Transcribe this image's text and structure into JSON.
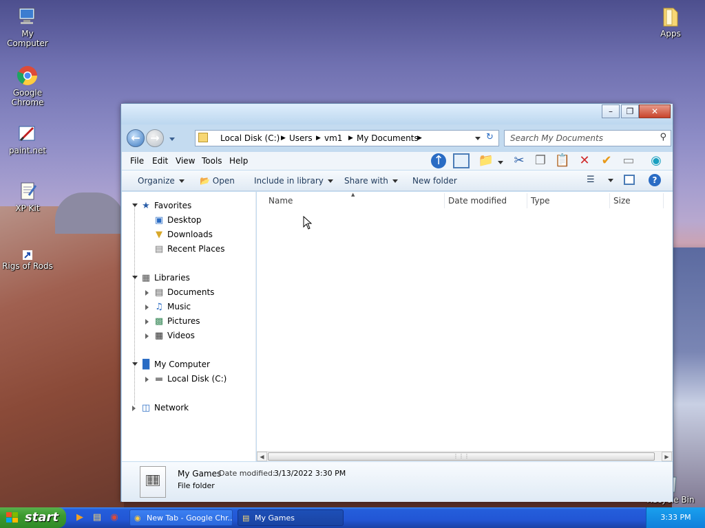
{
  "desktop": {
    "icons": [
      {
        "label": "My Computer",
        "icon": "computer-icon"
      },
      {
        "label": "Google Chrome",
        "icon": "chrome-icon"
      },
      {
        "label": "paint.net",
        "icon": "paintnet-icon"
      },
      {
        "label": "XP Kit",
        "icon": "notepad-icon"
      },
      {
        "label": "Rigs of Rods",
        "icon": "shortcut-icon"
      },
      {
        "label": "Apps",
        "icon": "folder-icon"
      },
      {
        "label": "Recycle Bin",
        "icon": "recycle-bin-icon"
      }
    ]
  },
  "window": {
    "address": {
      "crumbs": [
        "Local Disk (C:)",
        "Users",
        "vm1",
        "My Documents"
      ]
    },
    "search": {
      "placeholder": "Search My Documents"
    },
    "menu": [
      "File",
      "Edit",
      "View",
      "Tools",
      "Help"
    ],
    "commands": {
      "organize": "Organize",
      "open": "Open",
      "include": "Include in library",
      "share": "Share with",
      "new_folder": "New folder"
    },
    "nav": {
      "favorites": "Favorites",
      "desktop": "Desktop",
      "downloads": "Downloads",
      "recent": "Recent Places",
      "libraries": "Libraries",
      "documents": "Documents",
      "music": "Music",
      "pictures": "Pictures",
      "videos": "Videos",
      "computer": "My Computer",
      "localdisk": "Local Disk (C:)",
      "network": "Network"
    },
    "columns": [
      "Name",
      "Date modified",
      "Type",
      "Size"
    ],
    "details": {
      "name": "My Games",
      "date_label": "Date modified:",
      "date_value": "3/13/2022 3:30 PM",
      "type": "File folder"
    }
  },
  "taskbar": {
    "start": "start",
    "tasks": [
      {
        "label": "New Tab - Google Chr...",
        "icon": "chrome-icon"
      },
      {
        "label": "My Games",
        "icon": "folder-icon"
      }
    ],
    "clock": "3:33 PM"
  },
  "colors": {
    "taskbar": "#245edb",
    "start": "#3c9a2f",
    "close": "#c8442c"
  }
}
